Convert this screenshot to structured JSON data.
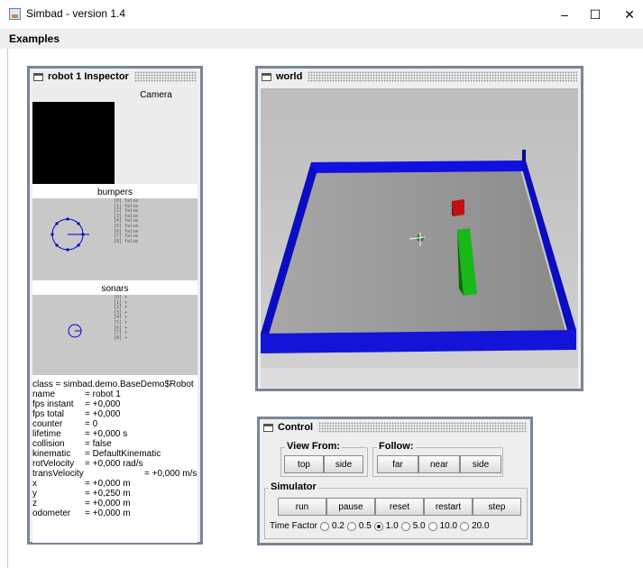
{
  "window": {
    "title": "Simbad  - version 1.4",
    "minimize": "–",
    "maximize": "☐",
    "close": "✕"
  },
  "menu": {
    "items": [
      "Examples"
    ]
  },
  "inspector": {
    "title": "robot 1 Inspector",
    "camera_label": "Camera",
    "bumpers_label": "bumpers",
    "bumpers": [
      "[0] false",
      "[1] false",
      "[2] false",
      "[3] false",
      "[4] false",
      "[5] false",
      "[6] false",
      "[7] false",
      "[8] false"
    ],
    "sonars_label": "sonars",
    "sonars": [
      "[0] +",
      "[1] +",
      "[2] +",
      "[3] +",
      "[4] +",
      "[5] +",
      "[6] +",
      "[7] +",
      "[8] +"
    ],
    "class_line": "class = simbad.demo.BaseDemo$Robot",
    "properties": [
      {
        "key": "name",
        "value": "= robot 1"
      },
      {
        "key": "fps instant",
        "value": "= +0,000"
      },
      {
        "key": "fps total",
        "value": "= +0,000"
      },
      {
        "key": "counter",
        "value": "= 0"
      },
      {
        "key": "lifetime",
        "value": "= +0,000 s"
      },
      {
        "key": "collision",
        "value": "= false"
      },
      {
        "key": "kinematic",
        "value": "= DefaultKinematic"
      },
      {
        "key": "rotVelocity",
        "value": "= +0,000 rad/s"
      }
    ],
    "trans_velocity": {
      "key": "transVelocity",
      "value": "= +0,000 m/s"
    },
    "properties2": [
      {
        "key": "x",
        "value": "= +0,000 m"
      },
      {
        "key": "y",
        "value": "= +0,250 m"
      },
      {
        "key": "z",
        "value": "= +0,000 m"
      },
      {
        "key": "odometer",
        "value": "= +0,000 m"
      }
    ]
  },
  "world": {
    "title": "world",
    "colors": {
      "wall": "#1010e0",
      "floor": "#9a9a9a",
      "box": "#d01010",
      "block": "#10b010"
    }
  },
  "control": {
    "title": "Control",
    "view_from_label": "View From:",
    "view_from": [
      "top",
      "side"
    ],
    "follow_label": "Follow:",
    "follow": [
      "far",
      "near",
      "side"
    ],
    "simulator_label": "Simulator",
    "simulator": [
      "run",
      "pause",
      "reset",
      "restart",
      "step"
    ],
    "time_factor_label": "Time Factor",
    "time_factors": [
      "0.2",
      "0.5",
      "1.0",
      "5.0",
      "10.0",
      "20.0"
    ],
    "time_factor_selected": "1.0"
  }
}
